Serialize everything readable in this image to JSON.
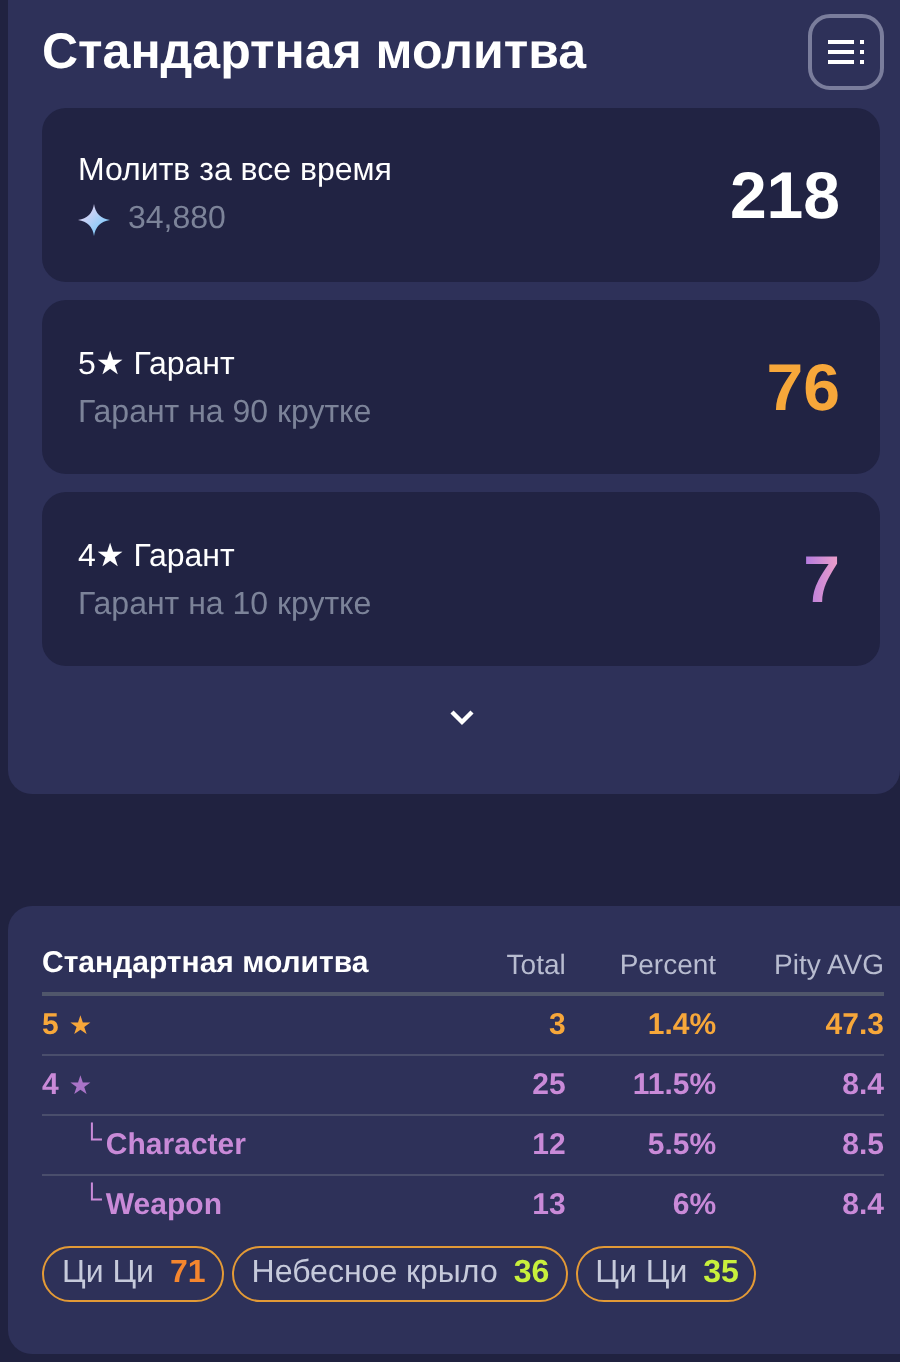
{
  "header": {
    "title": "Стандартная молитва"
  },
  "cards": [
    {
      "kind": "total",
      "label": "Молитв за все время",
      "sub": "34,880",
      "value": "218"
    },
    {
      "kind": "five",
      "label": "5★ Гарант",
      "sub": "Гарант на 90 крутке",
      "value": "76"
    },
    {
      "kind": "four",
      "label": "4★ Гарант",
      "sub": "Гарант на 10 крутке",
      "value": "7"
    }
  ],
  "expand": {
    "expanded": false
  },
  "table": {
    "columns": [
      "Стандартная молитва",
      "Total",
      "Percent",
      "Pity AVG"
    ],
    "rows": [
      {
        "kind": "five",
        "star": "★",
        "cells": [
          "5",
          "3",
          "1.4%",
          "47.3"
        ]
      },
      {
        "kind": "four",
        "star": "★",
        "cells": [
          "4",
          "25",
          "11.5%",
          "8.4"
        ]
      },
      {
        "kind": "sub",
        "branch": "└",
        "cells": [
          "Character",
          "12",
          "5.5%",
          "8.5"
        ]
      },
      {
        "kind": "sub",
        "branch": "└",
        "cells": [
          "Weapon",
          "13",
          "6%",
          "8.4"
        ]
      }
    ]
  },
  "chips": [
    {
      "name": "Ци Ци",
      "count": "71",
      "color": "#f5862e"
    },
    {
      "name": "Небесное крыло",
      "count": "36",
      "color": "#c8f03c"
    },
    {
      "name": "Ци Ци",
      "count": "35",
      "color": "#c8f03c"
    }
  ]
}
